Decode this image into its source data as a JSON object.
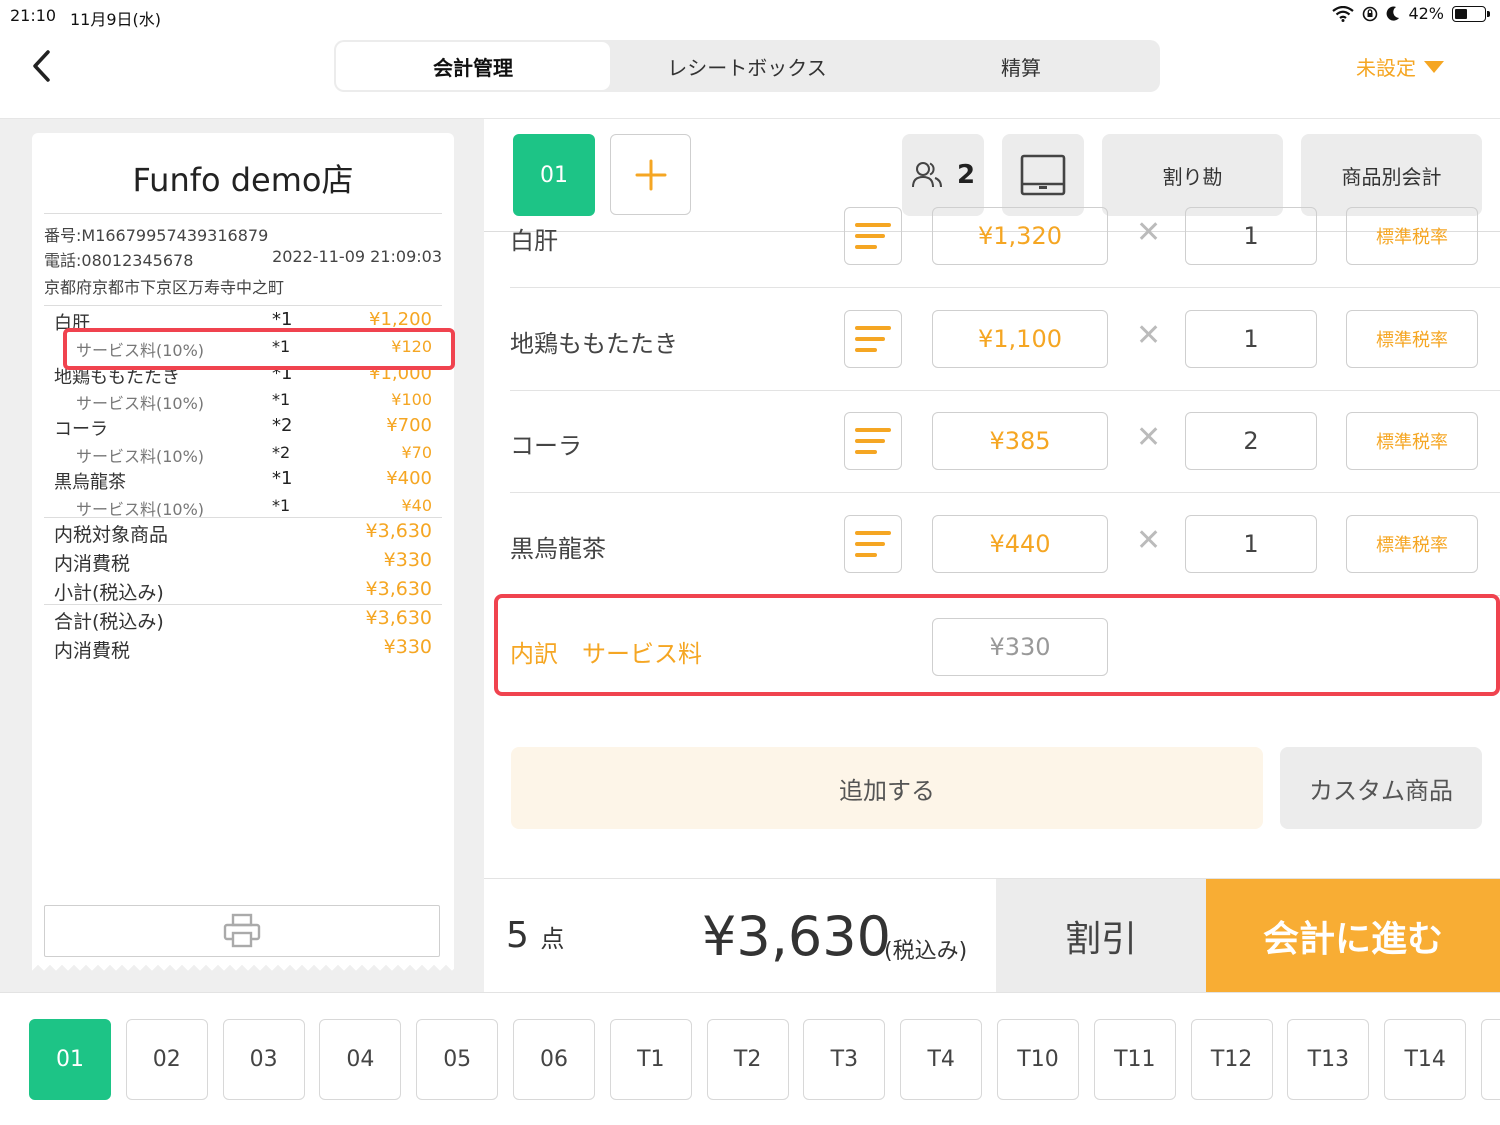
{
  "status": {
    "time": "21:10",
    "date": "11月9日(水)",
    "battery": "42%",
    "battery_level": 0.42
  },
  "header": {
    "tabs": [
      {
        "label": "会計管理",
        "active": true
      },
      {
        "label": "レシートボックス",
        "active": false
      },
      {
        "label": "精算",
        "active": false
      }
    ],
    "unset_label": "未設定"
  },
  "receipt": {
    "store_name": "Funfo demo店",
    "number": "番号:M16679957439316879",
    "phone": "電話:08012345678",
    "datetime": "2022-11-09 21:09:03",
    "address": "京都府京都市下京区万寿寺中之町",
    "lines": [
      {
        "name": "白肝",
        "qty": "*1",
        "price": "¥1,200",
        "sub": false
      },
      {
        "name": "サービス料(10%)",
        "qty": "*1",
        "price": "¥120",
        "sub": true
      },
      {
        "name": "地鶏ももたたき",
        "qty": "*1",
        "price": "¥1,000",
        "sub": false
      },
      {
        "name": "サービス料(10%)",
        "qty": "*1",
        "price": "¥100",
        "sub": true
      },
      {
        "name": "コーラ",
        "qty": "*2",
        "price": "¥700",
        "sub": false
      },
      {
        "name": "サービス料(10%)",
        "qty": "*2",
        "price": "¥70",
        "sub": true
      },
      {
        "name": "黒烏龍茶",
        "qty": "*1",
        "price": "¥400",
        "sub": false
      },
      {
        "name": "サービス料(10%)",
        "qty": "*1",
        "price": "¥40",
        "sub": true
      }
    ],
    "totals": [
      {
        "name": "内税対象商品",
        "price": "¥3,630"
      },
      {
        "name": "内消費税",
        "price": "¥330"
      },
      {
        "name": "小計(税込み)",
        "price": "¥3,630"
      },
      {
        "name": "合計(税込み)",
        "price": "¥3,630"
      },
      {
        "name": "内消費税",
        "price": "¥330"
      }
    ]
  },
  "order": {
    "tab_label": "01",
    "guests": "2",
    "split_label": "割り勘",
    "by_item_label": "商品別会計",
    "items": [
      {
        "name": "白肝",
        "price": "¥1,320",
        "qty": "1",
        "tax": "標準税率"
      },
      {
        "name": "地鶏ももたたき",
        "price": "¥1,100",
        "qty": "1",
        "tax": "標準税率"
      },
      {
        "name": "コーラ",
        "price": "¥385",
        "qty": "2",
        "tax": "標準税率"
      },
      {
        "name": "黒烏龍茶",
        "price": "¥440",
        "qty": "1",
        "tax": "標準税率"
      }
    ],
    "breakdown_label": "内訳　サービス料",
    "breakdown_price": "¥330",
    "add_label": "追加する",
    "custom_label": "カスタム商品"
  },
  "footer": {
    "count": "5",
    "count_unit": "点",
    "total": "¥3,630",
    "total_note": "(税込み)",
    "discount_label": "割引",
    "checkout_label": "会計に進む"
  },
  "tables": [
    "01",
    "02",
    "03",
    "04",
    "05",
    "06",
    "T1",
    "T2",
    "T3",
    "T4",
    "T10",
    "T11",
    "T12",
    "T13",
    "T14"
  ],
  "active_table": "01",
  "colors": {
    "accent": "#f5a623",
    "green": "#1dc486",
    "highlight": "#f0434f"
  }
}
